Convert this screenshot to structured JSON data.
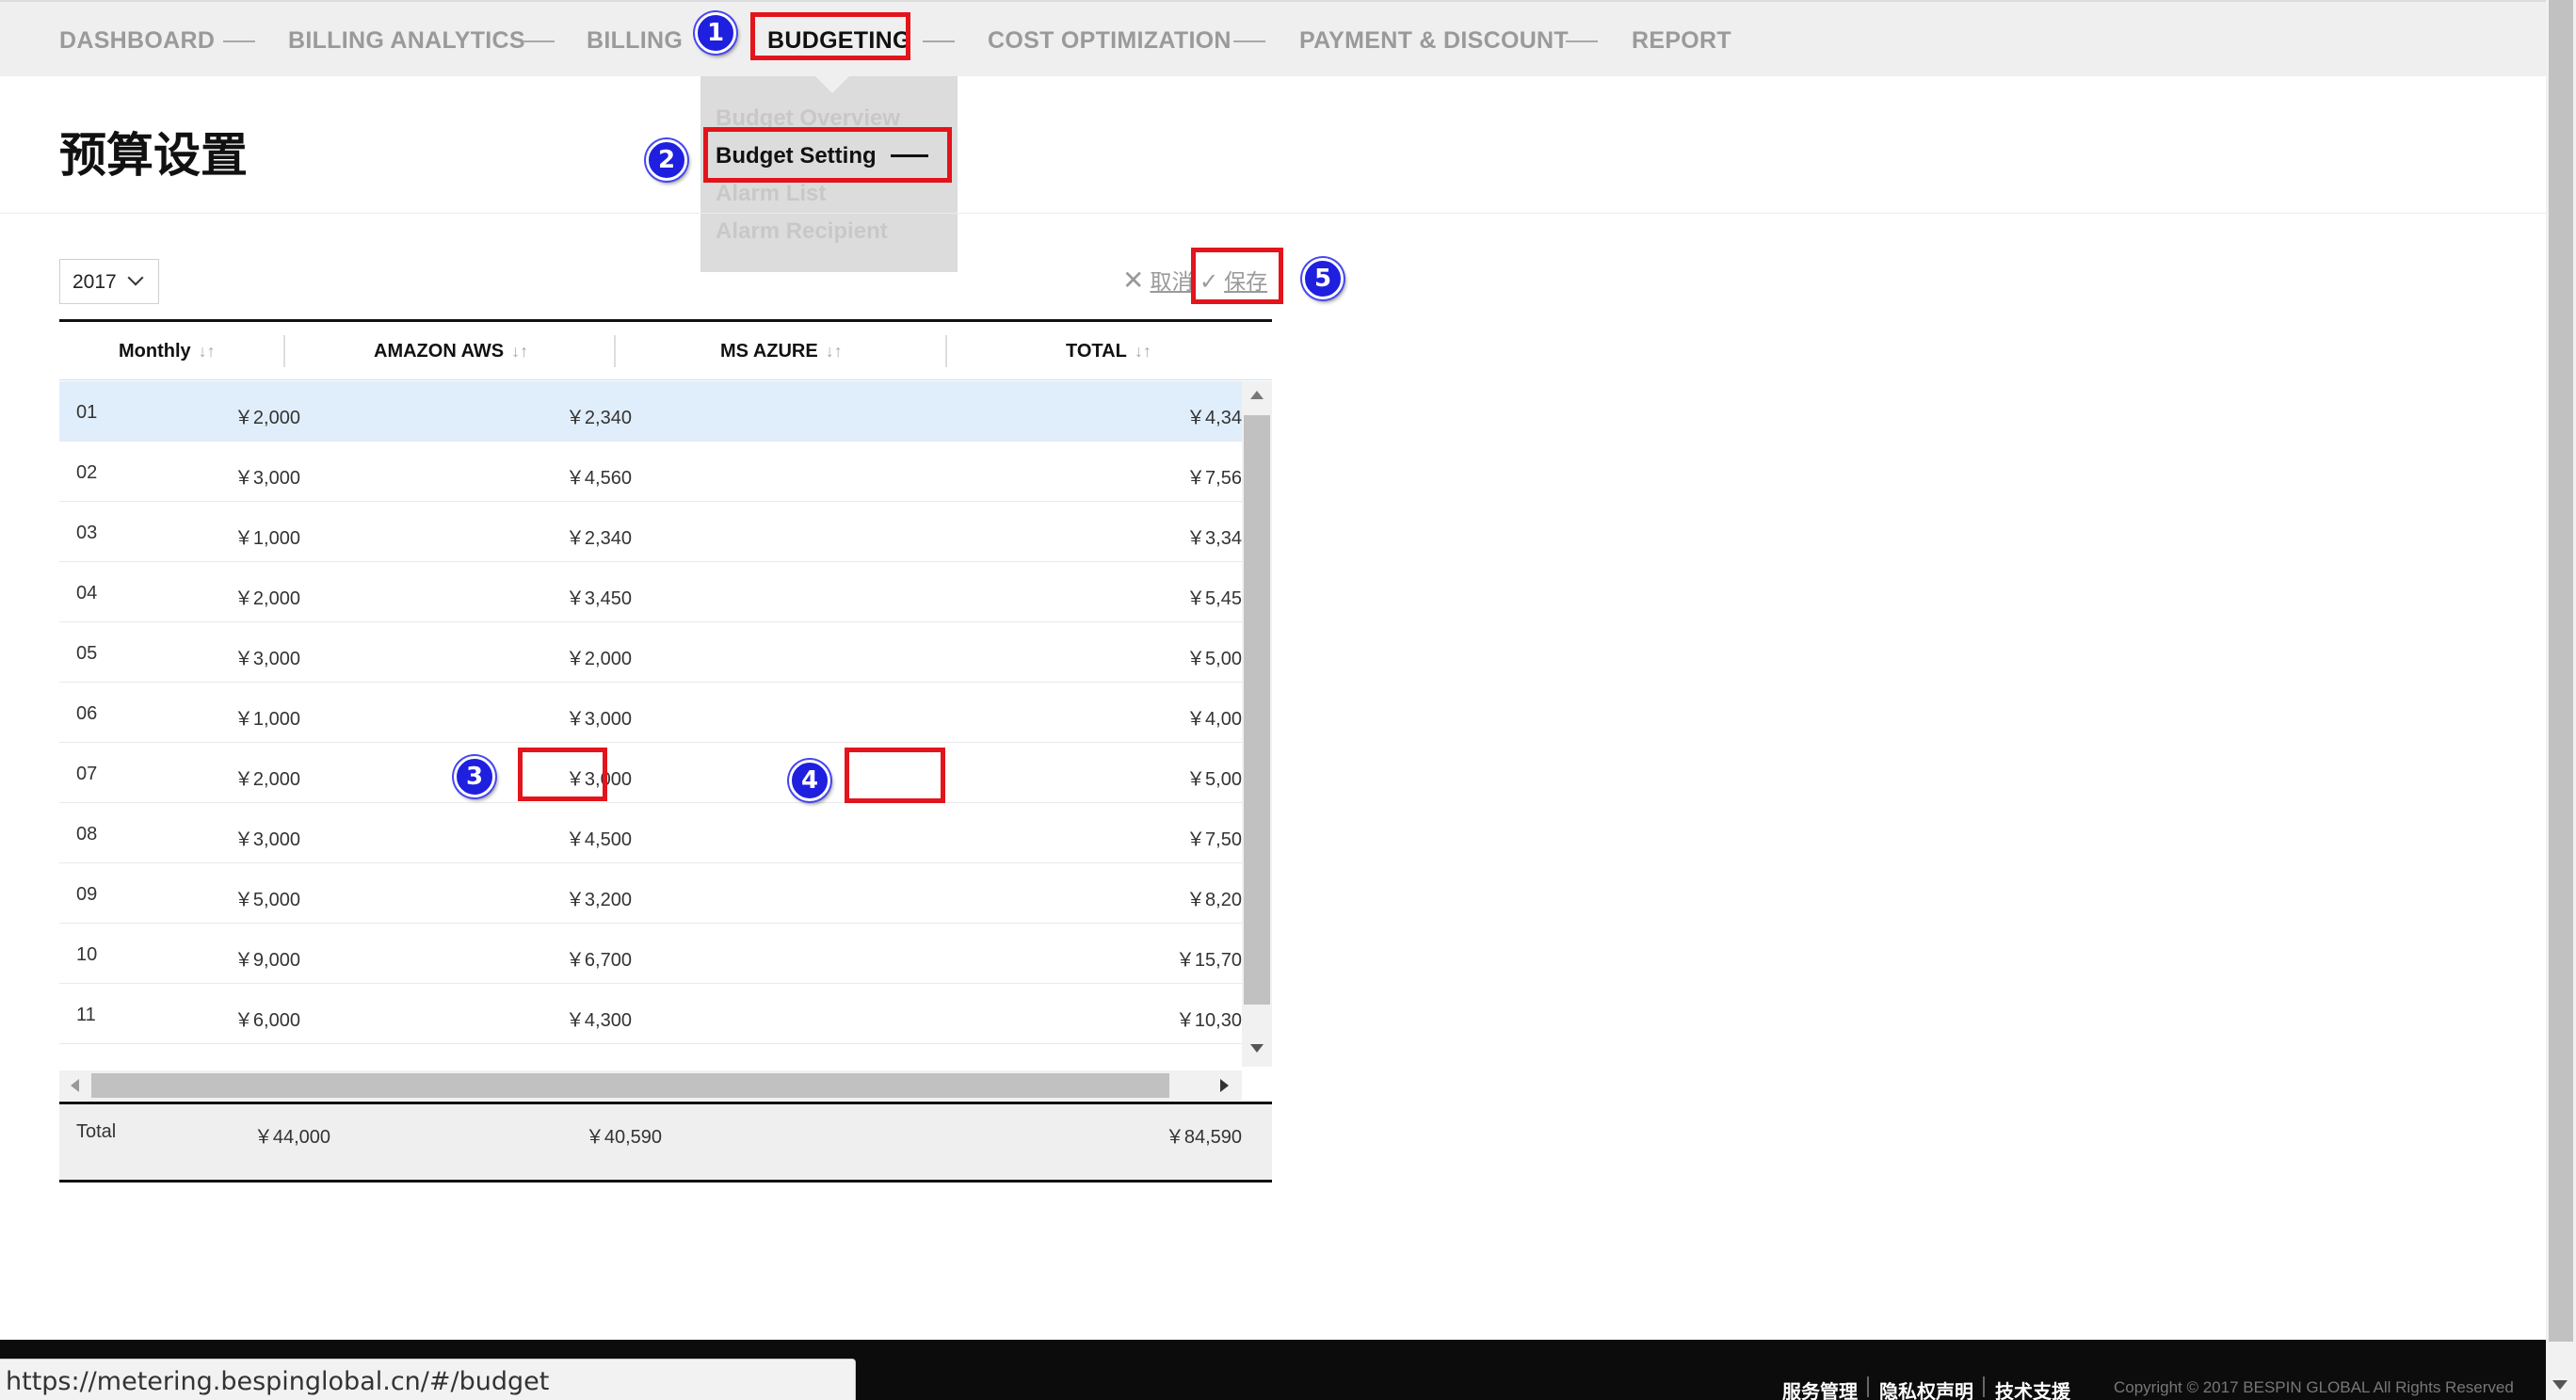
{
  "nav": {
    "items": [
      "DASHBOARD",
      "BILLING ANALYTICS",
      "BILLING",
      "BUDGETING",
      "COST OPTIMIZATION",
      "PAYMENT & DISCOUNT",
      "REPORT"
    ],
    "active": "BUDGETING"
  },
  "dropdown": {
    "items": [
      "Budget Overview",
      "Budget Setting",
      "Alarm List",
      "Alarm Recipient"
    ],
    "active": "Budget Setting"
  },
  "page": {
    "title": "预算设置"
  },
  "year_select": {
    "value": "2017"
  },
  "actions": {
    "cancel_label": "取消",
    "save_label": "保存"
  },
  "table": {
    "headers": {
      "monthly": "Monthly",
      "aws": "AMAZON AWS",
      "azure": "MS AZURE",
      "total": "TOTAL",
      "sort_glyph": "↓↑"
    },
    "rows": [
      {
        "month": "01",
        "aws": "￥2,000",
        "azure": "￥2,340",
        "total": "￥4,34"
      },
      {
        "month": "02",
        "aws": "￥3,000",
        "azure": "￥4,560",
        "total": "￥7,56"
      },
      {
        "month": "03",
        "aws": "￥1,000",
        "azure": "￥2,340",
        "total": "￥3,34"
      },
      {
        "month": "04",
        "aws": "￥2,000",
        "azure": "￥3,450",
        "total": "￥5,45"
      },
      {
        "month": "05",
        "aws": "￥3,000",
        "azure": "￥2,000",
        "total": "￥5,00"
      },
      {
        "month": "06",
        "aws": "￥1,000",
        "azure": "￥3,000",
        "total": "￥4,00"
      },
      {
        "month": "07",
        "aws": "￥2,000",
        "azure": "￥3,000",
        "total": "￥5,00"
      },
      {
        "month": "08",
        "aws": "￥3,000",
        "azure": "￥4,500",
        "total": "￥7,50"
      },
      {
        "month": "09",
        "aws": "￥5,000",
        "azure": "￥3,200",
        "total": "￥8,20"
      },
      {
        "month": "10",
        "aws": "￥9,000",
        "azure": "￥6,700",
        "total": "￥15,70"
      },
      {
        "month": "11",
        "aws": "￥6,000",
        "azure": "￥4,300",
        "total": "￥10,30"
      }
    ],
    "total_row": {
      "label": "Total",
      "aws": "￥44,000",
      "azure": "￥40,590",
      "total": "￥84,590"
    }
  },
  "annotations": [
    "1",
    "2",
    "3",
    "4",
    "5"
  ],
  "footer": {
    "links": [
      "服务管理",
      "隐私权声明",
      "技术支援"
    ],
    "copyright": "Copyright © 2017 BESPIN GLOBAL All Rights Reserved"
  },
  "statusbar": {
    "url": "https://metering.bespinglobal.cn/#/budget"
  },
  "colors": {
    "annotation_red": "#e3141b",
    "annotation_blue": "#1f1fe0",
    "row_highlight": "#e0eefb",
    "footer_bg": "#0c0c0c"
  }
}
